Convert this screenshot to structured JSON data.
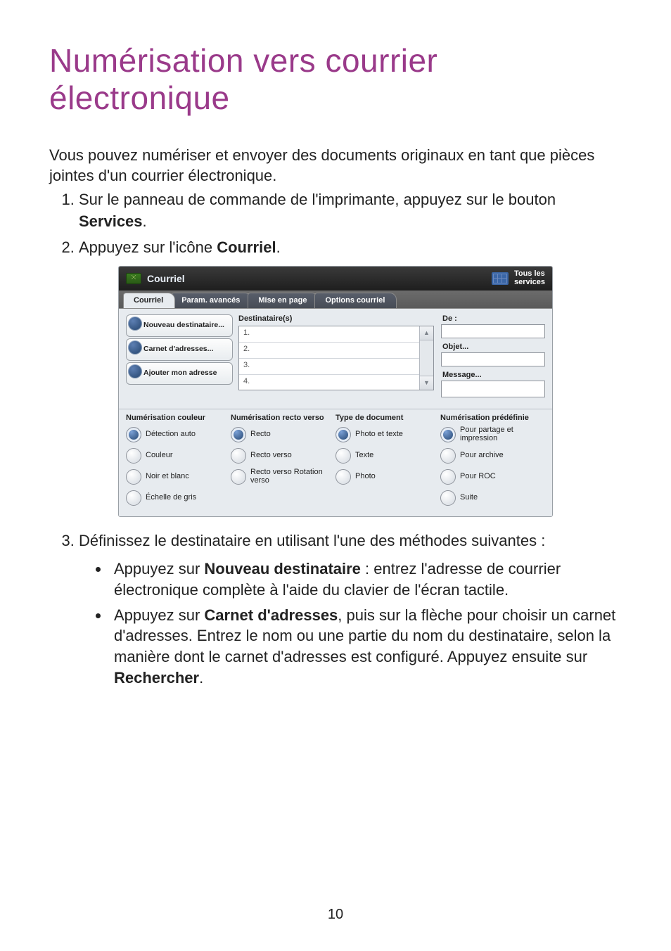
{
  "page_title": "Numérisation vers courrier électronique",
  "intro": "Vous pouvez numériser et envoyer des documents originaux en tant que pièces jointes d'un courrier électronique.",
  "steps": {
    "one_pre": "Sur le panneau de commande de l'imprimante, appuyez sur le bouton ",
    "one_bold": "Services",
    "one_post": ".",
    "two_pre": "Appuyez sur l'icône ",
    "two_bold": "Courriel",
    "two_post": ".",
    "three": "Définissez le destinataire en utilisant l'une des méthodes suivantes :"
  },
  "bullets": {
    "b1_pre": "Appuyez sur ",
    "b1_bold": "Nouveau destinataire",
    "b1_post": " : entrez l'adresse de courrier électronique complète à l'aide du clavier de l'écran tactile.",
    "b2_pre": "Appuyez sur ",
    "b2_bold": "Carnet d'adresses",
    "b2_mid": ", puis sur la flèche pour choisir un carnet d'adresses. Entrez le nom ou une partie du nom du destinataire, selon la manière dont le carnet d'adresses est configuré. Appuyez ensuite sur ",
    "b2_bold2": "Rechercher",
    "b2_post": "."
  },
  "page_number": "10",
  "screenshot": {
    "topbar": {
      "title": "Courriel",
      "all_services": "Tous les\nservices"
    },
    "tabs": [
      "Courriel",
      "Param. avancés",
      "Mise en page",
      "Options courriel"
    ],
    "left_buttons": [
      "Nouveau destinataire...",
      "Carnet d'adresses...",
      "Ajouter mon adresse"
    ],
    "recipients_header": "Destinataire(s)",
    "recipient_rows": [
      "1.",
      "2.",
      "3.",
      "4."
    ],
    "from_label": "De :",
    "subject_label": "Objet...",
    "message_label": "Message...",
    "option_columns": [
      {
        "header": "Numérisation couleur",
        "items": [
          "Détection auto",
          "Couleur",
          "Noir et blanc",
          "Échelle de gris"
        ],
        "selected": 0
      },
      {
        "header": "Numérisation recto verso",
        "items": [
          "Recto",
          "Recto verso",
          "Recto verso Rotation verso"
        ],
        "selected": 0
      },
      {
        "header": "Type de document",
        "items": [
          "Photo et texte",
          "Texte",
          "Photo"
        ],
        "selected": 0
      },
      {
        "header": "Numérisation prédéfinie",
        "items": [
          "Pour partage et impression",
          "Pour archive",
          "Pour ROC",
          "Suite"
        ],
        "selected": 0
      }
    ]
  }
}
